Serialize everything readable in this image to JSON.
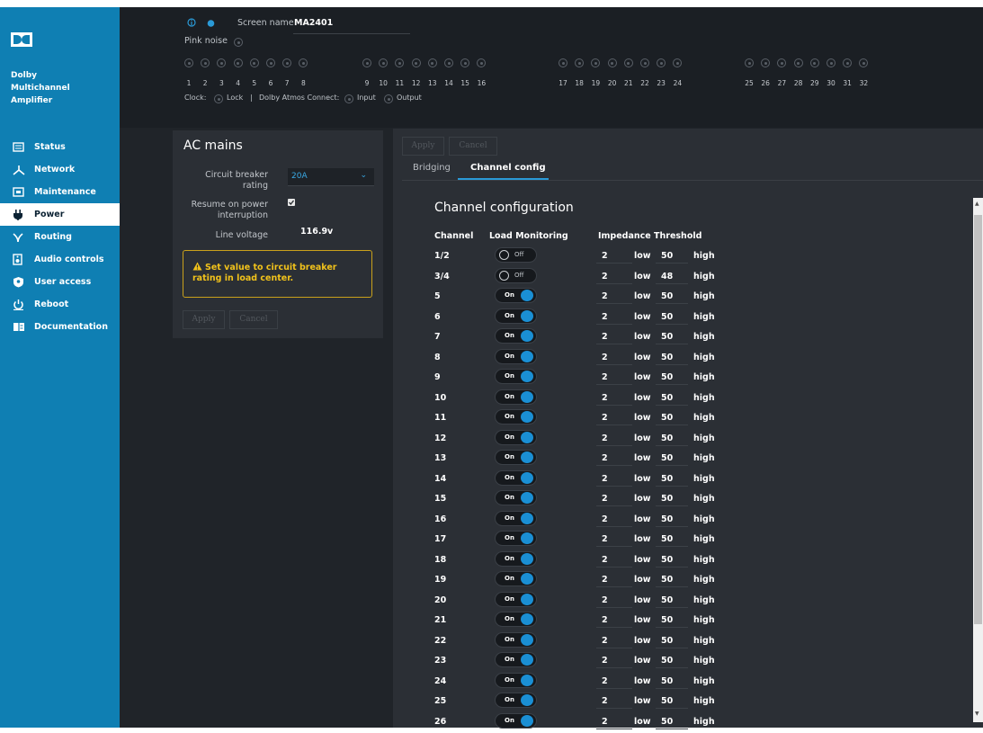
{
  "sidebar": {
    "product": [
      "Dolby",
      "Multichannel",
      "Amplifier"
    ],
    "items": [
      {
        "label": "Status",
        "icon": "status-icon"
      },
      {
        "label": "Network",
        "icon": "network-icon"
      },
      {
        "label": "Maintenance",
        "icon": "maintenance-icon"
      },
      {
        "label": "Power",
        "icon": "power-plug-icon",
        "active": true
      },
      {
        "label": "Routing",
        "icon": "routing-icon"
      },
      {
        "label": "Audio controls",
        "icon": "audio-controls-icon"
      },
      {
        "label": "User access",
        "icon": "user-access-icon"
      },
      {
        "label": "Reboot",
        "icon": "reboot-icon"
      },
      {
        "label": "Documentation",
        "icon": "documentation-icon"
      }
    ]
  },
  "header": {
    "screen_name_label": "Screen name",
    "screen_name": "MA2401",
    "pink_noise": "Pink noise",
    "channels": [
      "1",
      "2",
      "3",
      "4",
      "5",
      "6",
      "7",
      "8",
      "9",
      "10",
      "11",
      "12",
      "13",
      "14",
      "15",
      "16",
      "17",
      "18",
      "19",
      "20",
      "21",
      "22",
      "23",
      "24",
      "25",
      "26",
      "27",
      "28",
      "29",
      "30",
      "31",
      "32"
    ],
    "clock_label": "Clock:",
    "lock_label": "Lock",
    "separator": "|",
    "atmos_label": "Dolby Atmos Connect:",
    "input_label": "Input",
    "output_label": "Output"
  },
  "ac_mains": {
    "title": "AC mains",
    "breaker_label": "Circuit breaker rating",
    "breaker_value": "20A",
    "resume_label": "Resume on power interruption",
    "resume_checked": true,
    "line_voltage_label": "Line voltage",
    "line_voltage": "116.9v",
    "warning": "Set value to circuit breaker rating in load center.",
    "apply": "Apply",
    "cancel": "Cancel"
  },
  "channel_panel": {
    "apply": "Apply",
    "cancel": "Cancel",
    "tabs": [
      "Bridging",
      "Channel config"
    ],
    "active_tab": "Channel config",
    "title": "Channel configuration",
    "columns": {
      "channel": "Channel",
      "load": "Load Monitoring",
      "impedance": "Impedance Threshold"
    },
    "low_label": "low",
    "high_label": "high",
    "rows": [
      {
        "ch": "1/2",
        "state": "Off",
        "low": "2",
        "high": "50"
      },
      {
        "ch": "3/4",
        "state": "Off",
        "low": "2",
        "high": "48"
      },
      {
        "ch": "5",
        "state": "On",
        "low": "2",
        "high": "50"
      },
      {
        "ch": "6",
        "state": "On",
        "low": "2",
        "high": "50"
      },
      {
        "ch": "7",
        "state": "On",
        "low": "2",
        "high": "50"
      },
      {
        "ch": "8",
        "state": "On",
        "low": "2",
        "high": "50"
      },
      {
        "ch": "9",
        "state": "On",
        "low": "2",
        "high": "50"
      },
      {
        "ch": "10",
        "state": "On",
        "low": "2",
        "high": "50"
      },
      {
        "ch": "11",
        "state": "On",
        "low": "2",
        "high": "50"
      },
      {
        "ch": "12",
        "state": "On",
        "low": "2",
        "high": "50"
      },
      {
        "ch": "13",
        "state": "On",
        "low": "2",
        "high": "50"
      },
      {
        "ch": "14",
        "state": "On",
        "low": "2",
        "high": "50"
      },
      {
        "ch": "15",
        "state": "On",
        "low": "2",
        "high": "50"
      },
      {
        "ch": "16",
        "state": "On",
        "low": "2",
        "high": "50"
      },
      {
        "ch": "17",
        "state": "On",
        "low": "2",
        "high": "50"
      },
      {
        "ch": "18",
        "state": "On",
        "low": "2",
        "high": "50"
      },
      {
        "ch": "19",
        "state": "On",
        "low": "2",
        "high": "50"
      },
      {
        "ch": "20",
        "state": "On",
        "low": "2",
        "high": "50"
      },
      {
        "ch": "21",
        "state": "On",
        "low": "2",
        "high": "50"
      },
      {
        "ch": "22",
        "state": "On",
        "low": "2",
        "high": "50"
      },
      {
        "ch": "23",
        "state": "On",
        "low": "2",
        "high": "50"
      },
      {
        "ch": "24",
        "state": "On",
        "low": "2",
        "high": "50"
      },
      {
        "ch": "25",
        "state": "On",
        "low": "2",
        "high": "50"
      },
      {
        "ch": "26",
        "state": "On",
        "low": "2",
        "high": "50"
      }
    ]
  },
  "colors": {
    "sidebar": "#0f7fb3",
    "accent": "#1a8fd4",
    "warning": "#f1c21b",
    "background": "#202429",
    "panel": "#2b2f35"
  }
}
